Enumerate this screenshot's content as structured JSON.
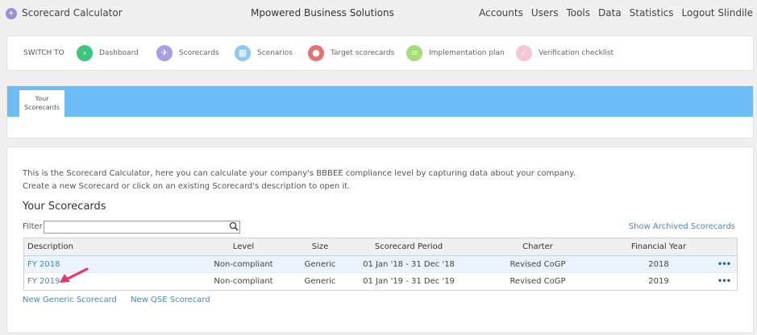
{
  "app": {
    "title": "Scorecard Calculator",
    "company": "Mpowered Business Solutions",
    "logo_icon": "paper-plane-icon"
  },
  "topnav": [
    "Accounts",
    "Users",
    "Tools",
    "Data",
    "Statistics",
    "Logout Slindile"
  ],
  "switchbar": {
    "label": "SWITCH TO",
    "items": [
      {
        "label": "Dashboard",
        "icon": "chevron-right-icon",
        "glyph": "›",
        "color": "#3cc47c"
      },
      {
        "label": "Scorecards",
        "icon": "paper-plane-icon",
        "glyph": "✈",
        "color": "#a99ee3"
      },
      {
        "label": "Scenarios",
        "icon": "map-icon",
        "glyph": "▦",
        "color": "#8fc9ef"
      },
      {
        "label": "Target scorecards",
        "icon": "map-pin-icon",
        "glyph": "●",
        "color": "#e57373"
      },
      {
        "label": "Implementation plan",
        "icon": "list-icon",
        "glyph": "≡",
        "color": "#a8dc7a"
      },
      {
        "label": "Verification checklist",
        "icon": "check-icon",
        "glyph": "✓",
        "color": "#f7c5d6"
      }
    ]
  },
  "tabs": {
    "active_line1": "Your",
    "active_line2": "Scorecards",
    "strip_color": "#6cbcf5"
  },
  "main": {
    "intro_line1": "This is the Scorecard Calculator, here you can calculate your company's BBBEE compliance level by capturing data about your company.",
    "intro_line2": "Create a new Scorecard or click on an existing Scorecard's description to open it.",
    "section_title": "Your Scorecards",
    "filter_label": "Filter",
    "filter_value": "",
    "show_archived": "Show Archived Scorecards",
    "columns": {
      "description": "Description",
      "level": "Level",
      "size": "Size",
      "period": "Scorecard Period",
      "charter": "Charter",
      "fy": "Financial Year"
    },
    "rows": [
      {
        "description": "FY 2018",
        "level": "Non-compliant",
        "size": "Generic",
        "period": "01 Jan '18 - 31 Dec '18",
        "charter": "Revised CoGP",
        "fy": "2018",
        "more": "•••"
      },
      {
        "description": "FY 2019",
        "level": "Non-compliant",
        "size": "Generic",
        "period": "01 Jan '19 - 31 Dec '19",
        "charter": "Revised CoGP",
        "fy": "2019",
        "more": "•••"
      }
    ],
    "new_generic": "New Generic Scorecard",
    "new_qse": "New QSE Scorecard"
  },
  "colors": {
    "link": "#4a86c5",
    "arrow": "#e8336d"
  }
}
